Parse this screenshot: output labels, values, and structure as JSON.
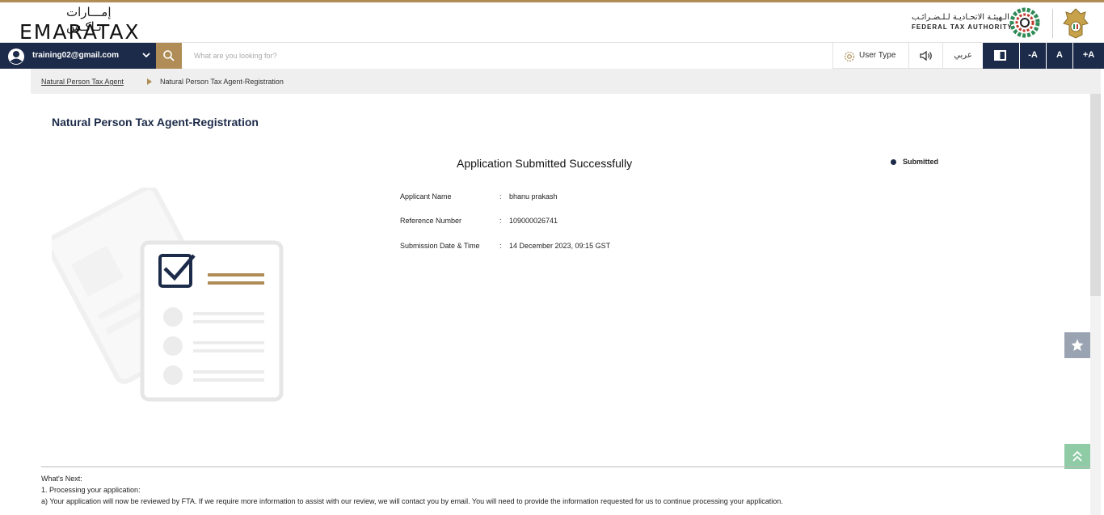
{
  "brand": {
    "logo_arabic": "إمـــارات تـاكـس",
    "logo_text": "EMARATAX",
    "authority_arabic": "الـهيئـة الاتحـاديـة لـلـضـرائـب",
    "authority_english": "FEDERAL TAX AUTHORITY"
  },
  "navbar": {
    "user_email": "training02@gmail.com",
    "search_placeholder": "What are you looking for?",
    "user_type_label": "User Type",
    "language_label": "عربي",
    "font_decrease": "-A",
    "font_normal": "A",
    "font_increase": "+A"
  },
  "breadcrumb": {
    "parent": "Natural Person Tax Agent",
    "current": "Natural Person Tax Agent-Registration"
  },
  "page": {
    "title": "Natural Person Tax Agent-Registration",
    "status": "Submitted",
    "success_message": "Application Submitted Successfully",
    "details": [
      {
        "label": "Applicant Name",
        "value": "bhanu prakash"
      },
      {
        "label": "Reference Number",
        "value": "109000026741"
      },
      {
        "label": "Submission Date & Time",
        "value": "14 December 2023, 09:15 GST"
      }
    ],
    "separator": ":"
  },
  "next_steps": {
    "heading": "What's Next:",
    "item1": "1.  Processing your application:",
    "item2": "a)  Your application will now be reviewed by FTA. If we require more information to assist with our review, we will contact you by email. You will need to provide the information requested for us to continue processing your application."
  },
  "colors": {
    "navy": "#1c2b49",
    "gold": "#b08d57",
    "green_button": "#8fcba5"
  }
}
